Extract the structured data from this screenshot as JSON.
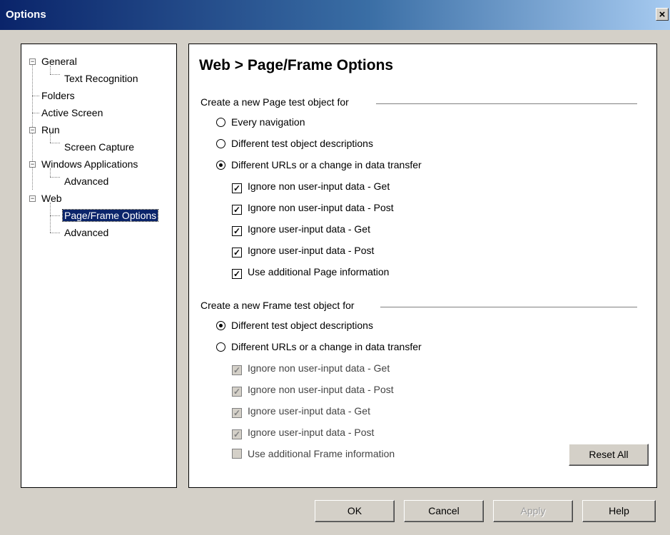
{
  "window": {
    "title": "Options",
    "close_glyph": "×"
  },
  "tree": {
    "nodes": [
      {
        "label": "General",
        "expander": "−"
      },
      {
        "label": "Text Recognition"
      },
      {
        "label": "Folders"
      },
      {
        "label": "Active Screen"
      },
      {
        "label": "Run",
        "expander": "−"
      },
      {
        "label": "Screen Capture"
      },
      {
        "label": "Windows Applications",
        "expander": "−"
      },
      {
        "label": "Advanced"
      },
      {
        "label": "Web",
        "expander": "−"
      },
      {
        "label": "Page/Frame Options",
        "selected": true
      },
      {
        "label": "Advanced"
      }
    ]
  },
  "content": {
    "title": "Web > Page/Frame Options",
    "page_group": {
      "label": "Create a new Page test object for",
      "radios": [
        {
          "label": "Every navigation",
          "checked": false
        },
        {
          "label": "Different test object descriptions",
          "checked": false
        },
        {
          "label": "Different URLs or a change in data transfer",
          "checked": true
        }
      ],
      "checks": [
        {
          "label": "Ignore non user-input data - Get",
          "checked": true
        },
        {
          "label": "Ignore non user-input data - Post",
          "checked": true
        },
        {
          "label": "Ignore user-input data - Get",
          "checked": true
        },
        {
          "label": "Ignore user-input data - Post",
          "checked": true
        },
        {
          "label": "Use additional Page information",
          "checked": true
        }
      ]
    },
    "frame_group": {
      "label": "Create a new Frame test object for",
      "radios": [
        {
          "label": "Different test object descriptions",
          "checked": true
        },
        {
          "label": "Different URLs or a change in data transfer",
          "checked": false
        }
      ],
      "checks": [
        {
          "label": "Ignore non user-input data - Get",
          "checked": true
        },
        {
          "label": "Ignore non user-input data - Post",
          "checked": true
        },
        {
          "label": "Ignore user-input data - Get",
          "checked": true
        },
        {
          "label": "Ignore user-input data - Post",
          "checked": true
        },
        {
          "label": "Use additional Frame information",
          "checked": false
        }
      ]
    },
    "reset_label": "Reset All"
  },
  "footer": {
    "ok": "OK",
    "cancel": "Cancel",
    "apply": "Apply",
    "help": "Help"
  },
  "colors": {
    "titlebar_start": "#0a246a",
    "titlebar_end": "#a6caf0",
    "selection": "#0a246a",
    "face": "#d4d0c8"
  }
}
